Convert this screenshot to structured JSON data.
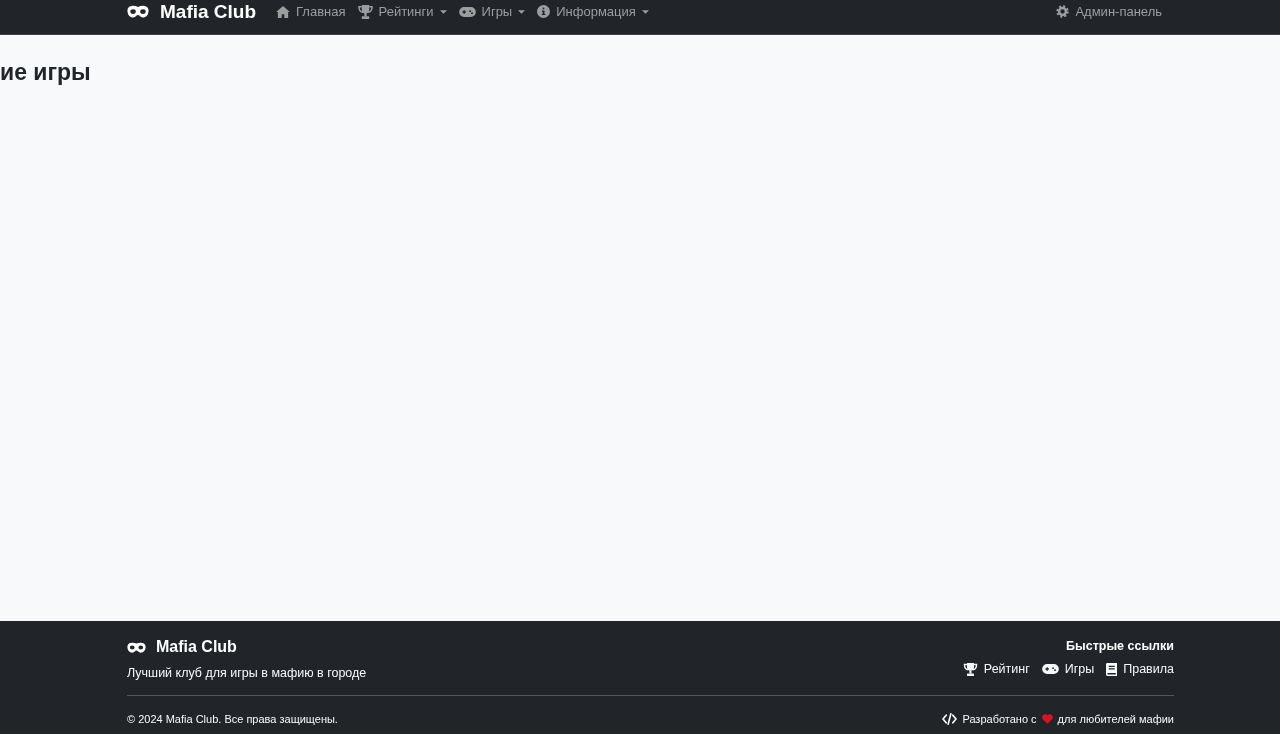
{
  "navbar": {
    "brand": "Mafia Club",
    "items": [
      {
        "label": "Главная",
        "dropdown": false,
        "selected": false
      },
      {
        "label": "Рейтинги",
        "dropdown": true,
        "selected": false
      },
      {
        "label": "Игры",
        "dropdown": true,
        "selected": false
      },
      {
        "label": "Информация",
        "dropdown": true,
        "selected": false
      }
    ],
    "admin_link": "Админ-панель"
  },
  "main": {
    "heading": "ие игры"
  },
  "footer": {
    "brand": "Mafia Club",
    "tagline": "Лучший клуб для игры в мафию в городе",
    "quick_links": {
      "title": "Быстрые ссылки",
      "items": [
        "Рейтинг",
        "Игры",
        "Правила"
      ]
    },
    "copyright": "© 2024 Mafia Club. Все права защищены.",
    "credit": {
      "before": "Разработано с",
      "after": "для любителей мафии"
    }
  }
}
